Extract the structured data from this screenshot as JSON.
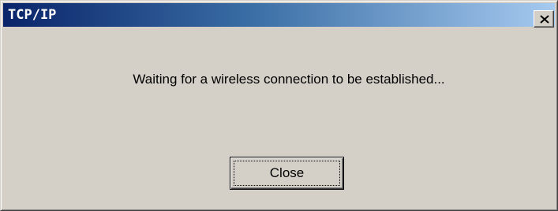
{
  "window": {
    "title": "TCP/IP",
    "close_icon": "close-x-icon"
  },
  "dialog": {
    "message": "Waiting for a wireless connection to be established...",
    "close_button_label": "Close"
  }
}
